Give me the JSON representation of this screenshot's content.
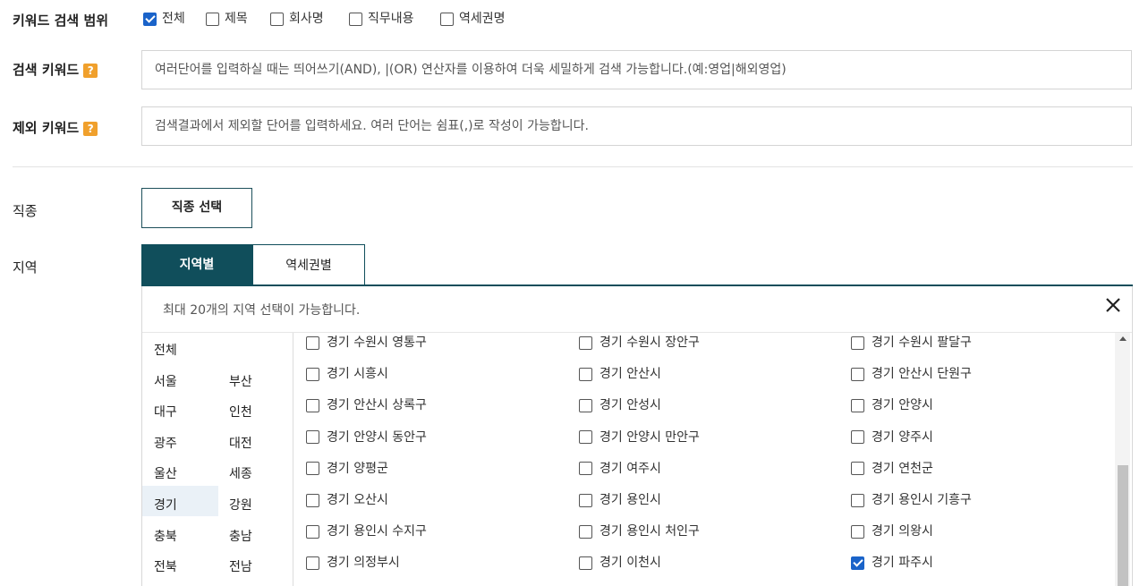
{
  "keyword_scope": {
    "label": "키워드 검색 범위",
    "options": [
      {
        "label": "전체",
        "checked": true
      },
      {
        "label": "제목",
        "checked": false
      },
      {
        "label": "회사명",
        "checked": false
      },
      {
        "label": "직무내용",
        "checked": false
      },
      {
        "label": "역세권명",
        "checked": false
      }
    ]
  },
  "search_keyword": {
    "label": "검색 키워드",
    "help": "?",
    "placeholder": "여러단어를 입력하실 때는 띄어쓰기(AND), |(OR) 연산자를 이용하여 더욱 세밀하게 검색 가능합니다.(예:영업|해외영업)"
  },
  "exclude_keyword": {
    "label": "제외 키워드",
    "help": "?",
    "placeholder": "검색결과에서 제외할 단어를 입력하세요. 여러 단어는 쉼표(,)로 작성이 가능합니다."
  },
  "job": {
    "label": "직종",
    "button": "직종 선택"
  },
  "region": {
    "label": "지역",
    "tabs": [
      "지역별",
      "역세권별"
    ],
    "note": "최대 20개의 지역 선택이 가능합니다.",
    "provinces": [
      [
        "전체"
      ],
      [
        "서울",
        "부산"
      ],
      [
        "대구",
        "인천"
      ],
      [
        "광주",
        "대전"
      ],
      [
        "울산",
        "세종"
      ],
      [
        "경기",
        "강원"
      ],
      [
        "충북",
        "충남"
      ],
      [
        "전북",
        "전남"
      ]
    ],
    "selected_province": "경기",
    "cities": [
      [
        {
          "name": "경기 수원시 영통구",
          "checked": false
        },
        {
          "name": "경기 수원시 장안구",
          "checked": false
        },
        {
          "name": "경기 수원시 팔달구",
          "checked": false
        }
      ],
      [
        {
          "name": "경기 시흥시",
          "checked": false
        },
        {
          "name": "경기 안산시",
          "checked": false
        },
        {
          "name": "경기 안산시 단원구",
          "checked": false
        }
      ],
      [
        {
          "name": "경기 안산시 상록구",
          "checked": false
        },
        {
          "name": "경기 안성시",
          "checked": false
        },
        {
          "name": "경기 안양시",
          "checked": false
        }
      ],
      [
        {
          "name": "경기 안양시 동안구",
          "checked": false
        },
        {
          "name": "경기 안양시 만안구",
          "checked": false
        },
        {
          "name": "경기 양주시",
          "checked": false
        }
      ],
      [
        {
          "name": "경기 양평군",
          "checked": false
        },
        {
          "name": "경기 여주시",
          "checked": false
        },
        {
          "name": "경기 연천군",
          "checked": false
        }
      ],
      [
        {
          "name": "경기 오산시",
          "checked": false
        },
        {
          "name": "경기 용인시",
          "checked": false
        },
        {
          "name": "경기 용인시 기흥구",
          "checked": false
        }
      ],
      [
        {
          "name": "경기 용인시 수지구",
          "checked": false
        },
        {
          "name": "경기 용인시 처인구",
          "checked": false
        },
        {
          "name": "경기 의왕시",
          "checked": false
        }
      ],
      [
        {
          "name": "경기 의정부시",
          "checked": false
        },
        {
          "name": "경기 이천시",
          "checked": false
        },
        {
          "name": "경기 파주시",
          "checked": true
        }
      ]
    ]
  }
}
